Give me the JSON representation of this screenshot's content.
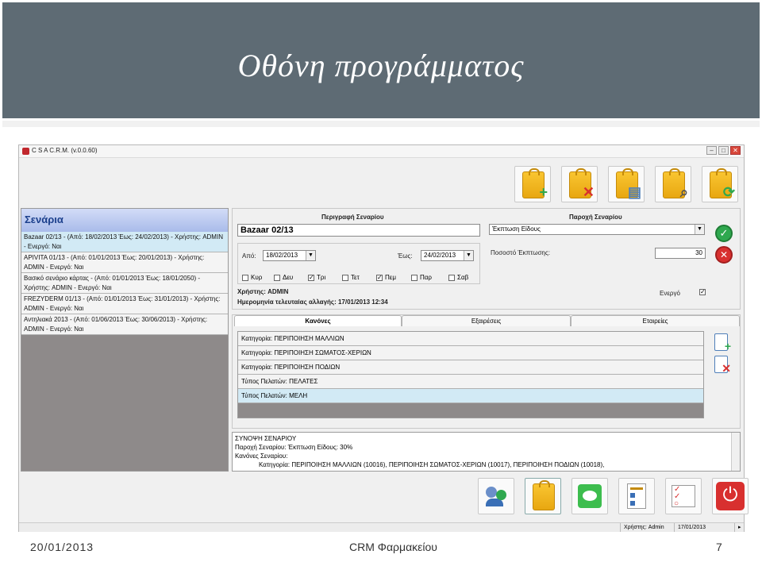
{
  "slide": {
    "title": "Οθόνη προγράμματος",
    "footer_date": "20/01/2013",
    "footer_center": "CRM Φαρμακείου",
    "page_number": "7"
  },
  "window": {
    "title": "C S A C.R.M.  (v.0.0.60)"
  },
  "left_panel": {
    "header": "Σενάρια",
    "items": [
      "Bazaar 02/13 - (Από: 18/02/2013 Έως: 24/02/2013) - Χρήστης: ADMIN - Ενεργό: Ναι",
      "APIVITA 01/13 - (Από: 01/01/2013 Έως: 20/01/2013) - Χρήστης: ADMIN - Ενεργό: Ναι",
      "Βασικό σενάριο κάρτας - (Από: 01/01/2013 Έως: 18/01/2050) - Χρήστης: ADMIN - Ενεργό: Ναι",
      "FREZYDERM 01/13 - (Από: 01/01/2013 Έως: 31/01/2013) - Χρήστης: ADMIN - Ενεργό: Ναι",
      "Αντηλιακά 2013 - (Από: 01/06/2013 Έως: 30/06/2013) - Χρήστης: ADMIN - Ενεργό: Ναι"
    ]
  },
  "details": {
    "description_label": "Περιγραφή Σεναρίου",
    "description_value": "Bazaar 02/13",
    "from_label": "Από:",
    "from_value": "18/02/2013",
    "to_label": "Έως:",
    "to_value": "24/02/2013",
    "days": [
      {
        "label": "Κυρ",
        "checked": false
      },
      {
        "label": "Δευ",
        "checked": false
      },
      {
        "label": "Τρι",
        "checked": true
      },
      {
        "label": "Τετ",
        "checked": false
      },
      {
        "label": "Πεμ",
        "checked": true
      },
      {
        "label": "Παρ",
        "checked": false
      },
      {
        "label": "Σαβ",
        "checked": false
      }
    ],
    "user_line": "Χρήστης: ADMIN",
    "last_change_line": "Ημερομηνία τελευταίας αλλαγής: 17/01/2013 12:34",
    "offer_label": "Παροχή Σεναρίου",
    "offer_value": "Έκπτωση Είδους",
    "discount_label": "Ποσοστό Έκπτωσης:",
    "discount_value": "30",
    "active_label": "Ενεργό",
    "active_checked": true
  },
  "tabs": [
    "Κανόνες",
    "Εξαιρέσεις",
    "Εταιρείες"
  ],
  "rules": [
    "Κατηγορία: ΠΕΡΙΠΟΙΗΣΗ ΜΑΛΛΙΩΝ",
    "Κατηγορία: ΠΕΡΙΠΟΙΗΣΗ ΣΩΜΑΤΟΣ-ΧΕΡΙΩΝ",
    "Κατηγορία: ΠΕΡΙΠΟΙΗΣΗ ΠΟΔΙΩΝ",
    "Τύπος Πελατών: ΠΕΛΑΤΕΣ",
    "Τύπος Πελατών: ΜΕΛΗ"
  ],
  "summary": {
    "line1": "ΣΥΝΟΨΗ ΣΕΝΑΡΙΟΥ",
    "line2": "Παροχή Σεναρίου: Έκπτωση Είδους: 30%",
    "line3": "Κανόνες Σεναρίου:",
    "line4": "Κατηγορία: ΠΕΡΙΠΟΙΗΣΗ ΜΑΛΛΙΩΝ (10016), ΠΕΡΙΠΟΙΗΣΗ ΣΩΜΑΤΟΣ-ΧΕΡΙΩΝ (10017), ΠΕΡΙΠΟΙΗΣΗ ΠΟΔΙΩΝ (10018),"
  },
  "statusbar": {
    "user": "Χρήστης: Admin",
    "date": "17/01/2013"
  },
  "icons": {
    "accent_bag": "#f1b722",
    "add_color": "#2fa84f",
    "delete_color": "#d8302f"
  }
}
